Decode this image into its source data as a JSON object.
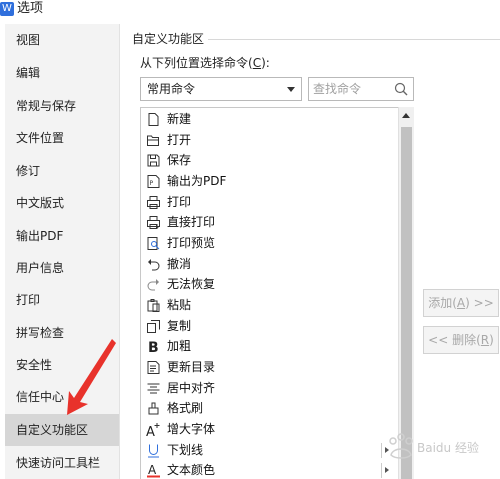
{
  "window": {
    "title": "选项",
    "icon": "app-options-icon"
  },
  "sidebar": {
    "items": [
      {
        "label": "视图"
      },
      {
        "label": "编辑"
      },
      {
        "label": "常规与保存"
      },
      {
        "label": "文件位置"
      },
      {
        "label": "修订"
      },
      {
        "label": "中文版式"
      },
      {
        "label": "输出PDF"
      },
      {
        "label": "用户信息"
      },
      {
        "label": "打印"
      },
      {
        "label": "拼写检查"
      },
      {
        "label": "安全性"
      },
      {
        "label": "信任中心"
      },
      {
        "label": "自定义功能区"
      },
      {
        "label": "快速访问工具栏"
      }
    ],
    "active_index": 12
  },
  "annotation": {
    "arrow_color": "#e8322b"
  },
  "main": {
    "group_title": "自定义功能区",
    "source_label_prefix": "从下列位置选择命令(",
    "source_label_key": "C",
    "source_label_suffix": "):",
    "source_select_value": "常用命令",
    "search_placeholder": "查找命令",
    "commands": [
      {
        "label": "新建",
        "icon": "new-document-icon"
      },
      {
        "label": "打开",
        "icon": "open-folder-icon"
      },
      {
        "label": "保存",
        "icon": "save-icon"
      },
      {
        "label": "输出为PDF",
        "icon": "export-pdf-icon"
      },
      {
        "label": "打印",
        "icon": "printer-icon"
      },
      {
        "label": "直接打印",
        "icon": "direct-print-icon"
      },
      {
        "label": "打印预览",
        "icon": "print-preview-icon"
      },
      {
        "label": "撤消",
        "icon": "undo-icon"
      },
      {
        "label": "无法恢复",
        "icon": "redo-icon"
      },
      {
        "label": "粘贴",
        "icon": "paste-icon"
      },
      {
        "label": "复制",
        "icon": "copy-icon"
      },
      {
        "label": "加粗",
        "icon": "bold-icon"
      },
      {
        "label": "更新目录",
        "icon": "update-toc-icon"
      },
      {
        "label": "居中对齐",
        "icon": "align-center-icon"
      },
      {
        "label": "格式刷",
        "icon": "format-painter-icon"
      },
      {
        "label": "增大字体",
        "icon": "increase-font-icon"
      },
      {
        "label": "下划线",
        "icon": "underline-icon",
        "submenu": true
      },
      {
        "label": "文本颜色",
        "icon": "text-color-icon",
        "submenu": true
      }
    ],
    "add_button": {
      "prefix": "添加(",
      "key": "A",
      "suffix": ") >>"
    },
    "remove_button": {
      "prefix": "<< 删除(",
      "key": "R",
      "suffix": ")"
    }
  },
  "watermark": {
    "text": "Baidu 经验"
  },
  "colors": {
    "sidebar_bg": "#f3f3f3",
    "active_item_bg": "#d6d6d6",
    "disabled_text": "#a8a8a8",
    "app_icon": "#2f6fdc"
  }
}
